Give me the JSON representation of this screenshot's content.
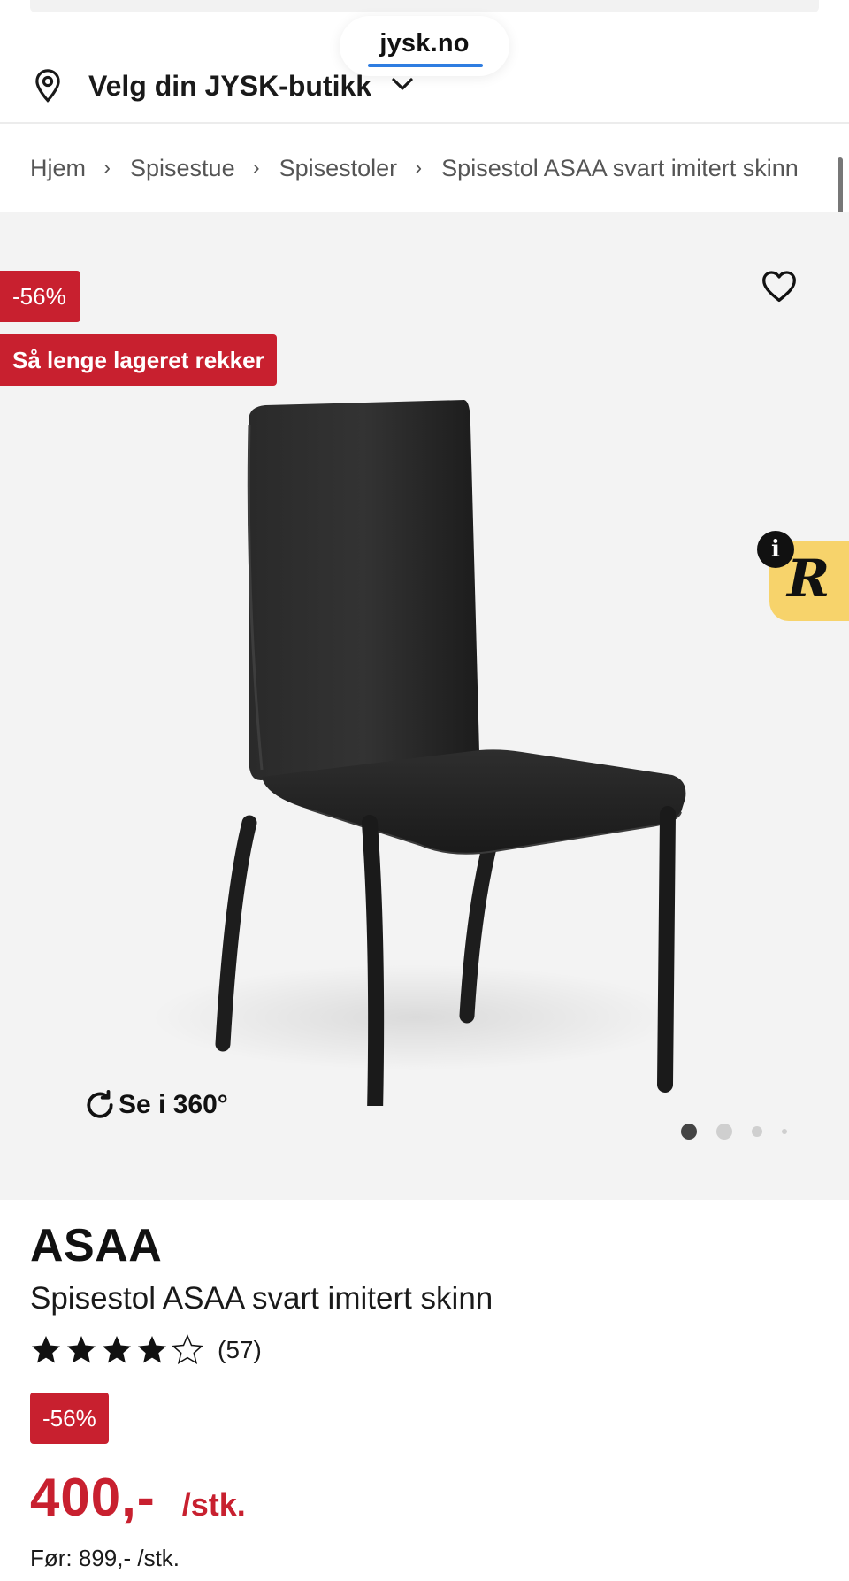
{
  "browser": {
    "url": "jysk.no"
  },
  "store_selector": {
    "label": "Velg din JYSK-butikk"
  },
  "breadcrumb": {
    "items": [
      "Hjem",
      "Spisestue",
      "Spisestoler",
      "Spisestol ASAA svart imitert skinn"
    ],
    "separator": "›"
  },
  "gallery": {
    "discount_badge": "-56%",
    "stock_badge": "Så lenge lageret rekker",
    "view360_label": "Se i 360°",
    "image_count": 4,
    "active_index": 0
  },
  "widget": {
    "info_label": "i",
    "logo_letter": "R"
  },
  "product": {
    "brand": "ASAA",
    "name": "Spisestol ASAA svart imitert skinn",
    "rating": 4.5,
    "review_count": "(57)",
    "discount_badge": "-56%",
    "price": "400,-",
    "unit": "/stk.",
    "before_price": "Før: 899,- /stk."
  },
  "colors": {
    "accent_red": "#c8202f",
    "widget_yellow": "#f7d36b",
    "progress_blue": "#2f7de1"
  }
}
